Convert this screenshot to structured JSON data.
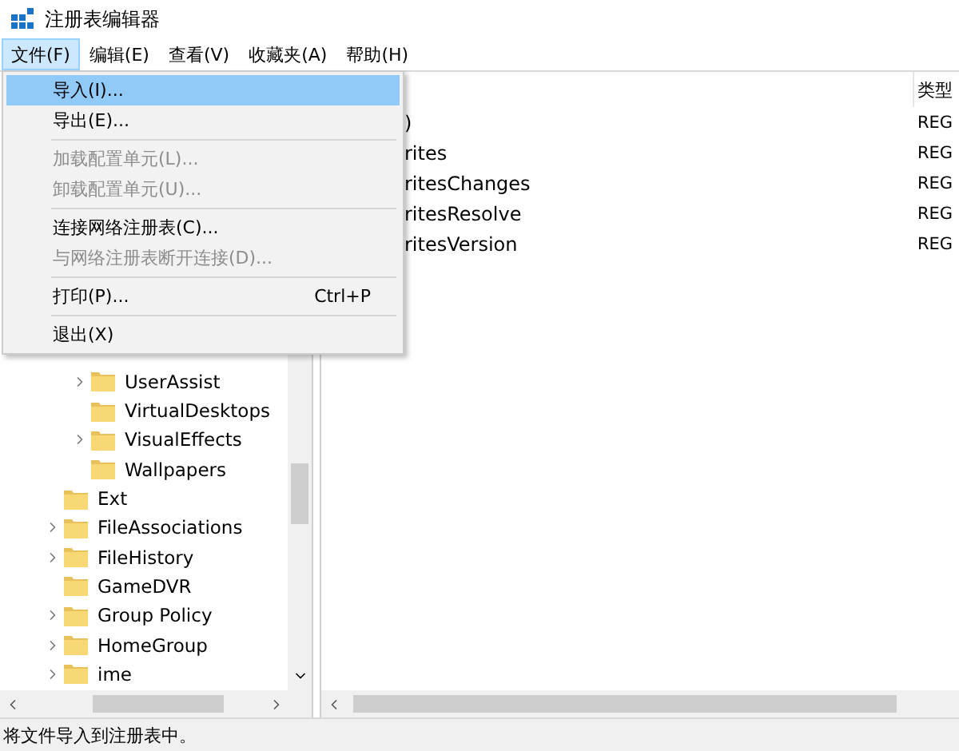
{
  "window": {
    "title": "注册表编辑器"
  },
  "menu_bar": [
    {
      "label": "文件(F)",
      "selected": true
    },
    {
      "label": "编辑(E)",
      "selected": false
    },
    {
      "label": "查看(V)",
      "selected": false
    },
    {
      "label": "收藏夹(A)",
      "selected": false
    },
    {
      "label": "帮助(H)",
      "selected": false
    }
  ],
  "file_menu": {
    "items": [
      {
        "kind": "item",
        "label": "导入(I)...",
        "selected": true,
        "disabled": false
      },
      {
        "kind": "item",
        "label": "导出(E)...",
        "selected": false,
        "disabled": false
      },
      {
        "kind": "separator"
      },
      {
        "kind": "item",
        "label": "加载配置单元(L)...",
        "selected": false,
        "disabled": true
      },
      {
        "kind": "item",
        "label": "卸载配置单元(U)...",
        "selected": false,
        "disabled": true
      },
      {
        "kind": "separator"
      },
      {
        "kind": "item",
        "label": "连接网络注册表(C)...",
        "selected": false,
        "disabled": false
      },
      {
        "kind": "item",
        "label": "与网络注册表断开连接(D)...",
        "selected": false,
        "disabled": true
      },
      {
        "kind": "separator"
      },
      {
        "kind": "item",
        "label": "打印(P)...",
        "shortcut": "Ctrl+P",
        "selected": false,
        "disabled": false
      },
      {
        "kind": "separator"
      },
      {
        "kind": "item",
        "label": "退出(X)",
        "selected": false,
        "disabled": false
      }
    ]
  },
  "tree": {
    "items": [
      {
        "children": [
          {
            "label": "UserAssist",
            "has_children": true
          },
          {
            "label": "VirtualDesktops",
            "has_children": false
          },
          {
            "label": "VisualEffects",
            "has_children": true
          },
          {
            "label": "Wallpapers",
            "has_children": false
          }
        ]
      },
      {
        "label": "Ext",
        "has_children": false
      },
      {
        "label": "FileAssociations",
        "has_children": true
      },
      {
        "label": "FileHistory",
        "has_children": true
      },
      {
        "label": "GameDVR",
        "has_children": false
      },
      {
        "label": "Group Policy",
        "has_children": true
      },
      {
        "label": "HomeGroup",
        "has_children": true
      },
      {
        "label": "ime",
        "has_children": true
      }
    ]
  },
  "values": {
    "columns": [
      "类型"
    ],
    "rows": [
      {
        "name": ")",
        "type": "REG"
      },
      {
        "name": "rites",
        "type": "REG"
      },
      {
        "name": "ritesChanges",
        "type": "REG"
      },
      {
        "name": "ritesResolve",
        "type": "REG"
      },
      {
        "name": "ritesVersion",
        "type": "REG"
      }
    ]
  },
  "status_bar": "将文件导入到注册表中。"
}
